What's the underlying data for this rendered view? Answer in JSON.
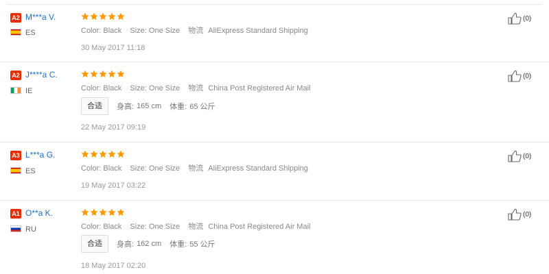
{
  "reviews": [
    {
      "badge": "A2",
      "user": "M***a V.",
      "country_code": "es",
      "country": "ES",
      "rating": 5,
      "color_label": "Color:",
      "color": "Black",
      "size_label": "Size:",
      "size": "One Size",
      "shipping_label": "物流",
      "shipping": "AliExpress Standard Shipping",
      "date": "30 May 2017 11:18",
      "helpful": "(0)"
    },
    {
      "badge": "A2",
      "user": "J****a C.",
      "country_code": "ie",
      "country": "IE",
      "rating": 5,
      "color_label": "Color:",
      "color": "Black",
      "size_label": "Size:",
      "size": "One Size",
      "shipping_label": "物流",
      "shipping": "China Post Registered Air Mail",
      "fit": "合适",
      "height_label": "身高:",
      "height": "165 cm",
      "weight_label": "体重:",
      "weight": "65 公斤",
      "date": "22 May 2017 09:19",
      "helpful": "(0)"
    },
    {
      "badge": "A3",
      "user": "L***a G.",
      "country_code": "es",
      "country": "ES",
      "rating": 5,
      "color_label": "Color:",
      "color": "Black",
      "size_label": "Size:",
      "size": "One Size",
      "shipping_label": "物流",
      "shipping": "AliExpress Standard Shipping",
      "date": "19 May 2017 03:22",
      "helpful": "(0)"
    },
    {
      "badge": "A1",
      "user": "O**a K.",
      "country_code": "ru",
      "country": "RU",
      "rating": 5,
      "color_label": "Color:",
      "color": "Black",
      "size_label": "Size:",
      "size": "One Size",
      "shipping_label": "物流",
      "shipping": "China Post Registered Air Mail",
      "fit": "合适",
      "height_label": "身高:",
      "height": "162 cm",
      "weight_label": "体重:",
      "weight": "55 公斤",
      "date": "18 May 2017 02:20",
      "helpful": "(0)"
    }
  ],
  "colors": {
    "badge": "#e62e04",
    "user_link": "#1a6fc9",
    "star": "#ff9900"
  },
  "icons": {
    "star": "star-icon",
    "helpful": "thumbs-up-icon"
  }
}
